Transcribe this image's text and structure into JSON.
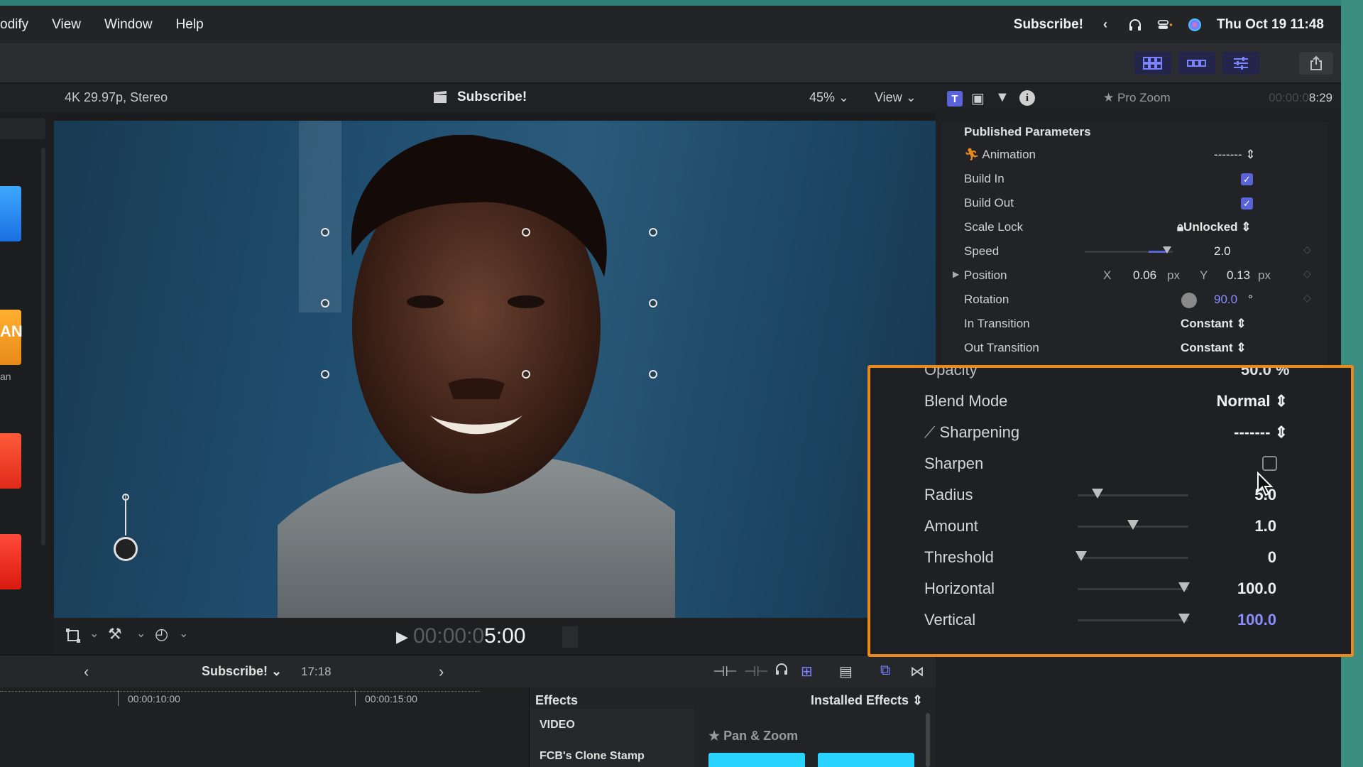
{
  "menubar": {
    "items": [
      "odify",
      "View",
      "Window",
      "Help"
    ],
    "right_label": "Subscribe!",
    "datetime": "Thu Oct 19  11:48"
  },
  "viewer_header": {
    "format": "4K 29.97p, Stereo",
    "project_title": "Subscribe!",
    "zoom": "45%",
    "view_menu": "View"
  },
  "viewer_controls": {
    "timecode_dim": "00:00:0",
    "timecode_bright": "5:00"
  },
  "browser_strip": {
    "thumb_text_1": "AN",
    "thumb_text_2": "an"
  },
  "timeline_header": {
    "project": "Subscribe!",
    "duration": "17:18"
  },
  "timeline": {
    "ticks": [
      "00:00:10:00",
      "00:00:15:00"
    ]
  },
  "effects": {
    "title": "Effects",
    "filter": "Installed Effects",
    "category": "VIDEO",
    "item": "FCB's Clone Stamp",
    "preset": "Pan & Zoom"
  },
  "inspector": {
    "effect_name": "Pro Zoom",
    "duration_dim": "00:00:0",
    "duration_bright": "8:29",
    "section": "Published Parameters",
    "animation": {
      "label": "Animation",
      "value": "-------"
    },
    "build_in": {
      "label": "Build In",
      "checked": true
    },
    "build_out": {
      "label": "Build Out",
      "checked": true
    },
    "scale_lock": {
      "label": "Scale Lock",
      "value": "Unlocked"
    },
    "speed": {
      "label": "Speed",
      "value": "2.0"
    },
    "position": {
      "label": "Position",
      "x_label": "X",
      "x": "0.06",
      "x_unit": "px",
      "y_label": "Y",
      "y": "0.13",
      "y_unit": "px"
    },
    "rotation": {
      "label": "Rotation",
      "value": "90.0",
      "unit": "°"
    },
    "in_transition": {
      "label": "In Transition",
      "value": "Constant"
    },
    "out_transition": {
      "label": "Out Transition",
      "value": "Constant"
    }
  },
  "callout": {
    "opacity_partial": "Opacity",
    "opacity_value": "50.0 %",
    "blend_mode": {
      "label": "Blend Mode",
      "value": "Normal"
    },
    "sharpening": {
      "label": "Sharpening",
      "value": "-------"
    },
    "sharpen": {
      "label": "Sharpen",
      "checked": false
    },
    "radius": {
      "label": "Radius",
      "value": "5.0",
      "level": 0.18
    },
    "amount": {
      "label": "Amount",
      "value": "1.0",
      "level": 0.5
    },
    "threshold": {
      "label": "Threshold",
      "value": "0",
      "level": 0.03
    },
    "horizontal": {
      "label": "Horizontal",
      "value": "100.0",
      "level": 0.96
    },
    "vertical": {
      "label": "Vertical",
      "value": "100.0",
      "level": 0.96
    }
  },
  "colors": {
    "accent": "#e8891a",
    "highlight_value": "#8a8fff",
    "checkbox": "#5a64d8"
  }
}
